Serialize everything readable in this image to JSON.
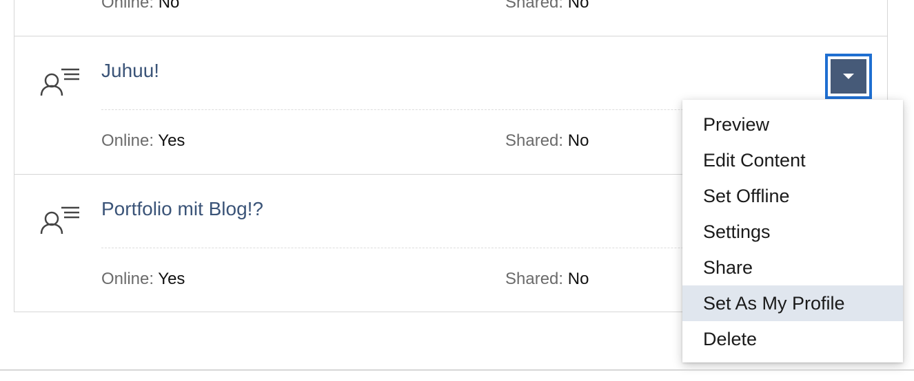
{
  "items": [
    {
      "title": "",
      "online_label": "Online:",
      "online_value": "No",
      "shared_label": "Shared:",
      "shared_value": "No"
    },
    {
      "title": "Juhuu!",
      "online_label": "Online:",
      "online_value": "Yes",
      "shared_label": "Shared:",
      "shared_value": "No"
    },
    {
      "title": "Portfolio mit Blog!?",
      "online_label": "Online:",
      "online_value": "Yes",
      "shared_label": "Shared:",
      "shared_value": "No"
    }
  ],
  "icon": "portfolio-list-icon",
  "dropdown_icon": "caret-down-icon",
  "menu": {
    "items": [
      {
        "label": "Preview"
      },
      {
        "label": "Edit Content"
      },
      {
        "label": "Set Offline"
      },
      {
        "label": "Settings"
      },
      {
        "label": "Share"
      },
      {
        "label": "Set As My Profile",
        "highlighted": true
      },
      {
        "label": "Delete"
      }
    ]
  },
  "colors": {
    "title": "#3b5478",
    "focus_ring": "#1f6fd1",
    "toggle_bg": "#465a78",
    "menu_highlight": "#e0e6ee"
  }
}
